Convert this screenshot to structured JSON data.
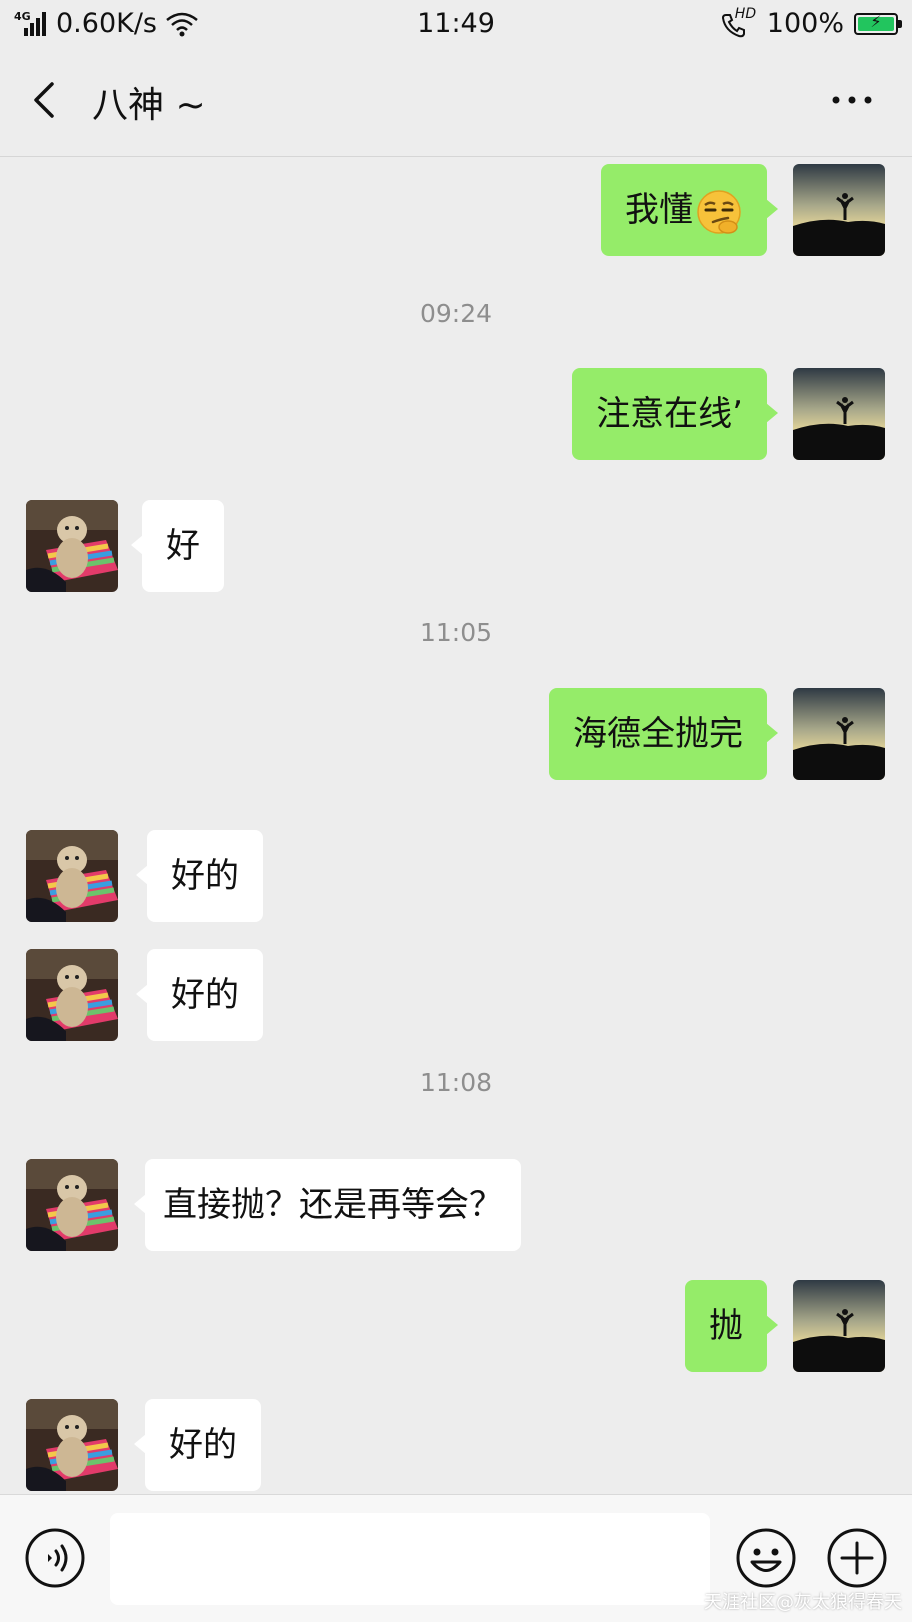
{
  "status_bar": {
    "network_type": "4G",
    "speed": "0.60K/s",
    "time": "11:49",
    "hd_label": "HD",
    "battery": "100%",
    "battery_level": 1.0,
    "battery_color": "#22c55e",
    "icons": [
      "signal-icon",
      "wifi-icon",
      "hd-call-icon",
      "battery-icon"
    ]
  },
  "header": {
    "title": "八神 ~",
    "back_icon": "chevron-left-icon",
    "more_icon": "more-dots-icon"
  },
  "messages": [
    {
      "type": "message",
      "sender": "self",
      "text": "我懂",
      "emoji": "smirk-emoji"
    },
    {
      "type": "timestamp",
      "text": "09:24"
    },
    {
      "type": "message",
      "sender": "self",
      "text": "注意在线’"
    },
    {
      "type": "message",
      "sender": "peer",
      "text": "好"
    },
    {
      "type": "timestamp",
      "text": "11:05"
    },
    {
      "type": "message",
      "sender": "self",
      "text": "海德全抛完"
    },
    {
      "type": "message",
      "sender": "peer",
      "text": "好的"
    },
    {
      "type": "message",
      "sender": "peer",
      "text": "好的"
    },
    {
      "type": "timestamp",
      "text": "11:08"
    },
    {
      "type": "message",
      "sender": "peer",
      "text": "直接抛？还是再等会？"
    },
    {
      "type": "message",
      "sender": "self",
      "text": "抛"
    },
    {
      "type": "message",
      "sender": "peer",
      "text": "好的"
    }
  ],
  "colors": {
    "self_bubble": "#95ec69",
    "peer_bubble": "#ffffff",
    "background": "#ededed"
  },
  "input_bar": {
    "value": "",
    "voice_icon": "voice-icon",
    "emoji_icon": "emoji-icon",
    "plus_icon": "plus-icon"
  },
  "watermark": "天涯社区@灰太狼得春天"
}
